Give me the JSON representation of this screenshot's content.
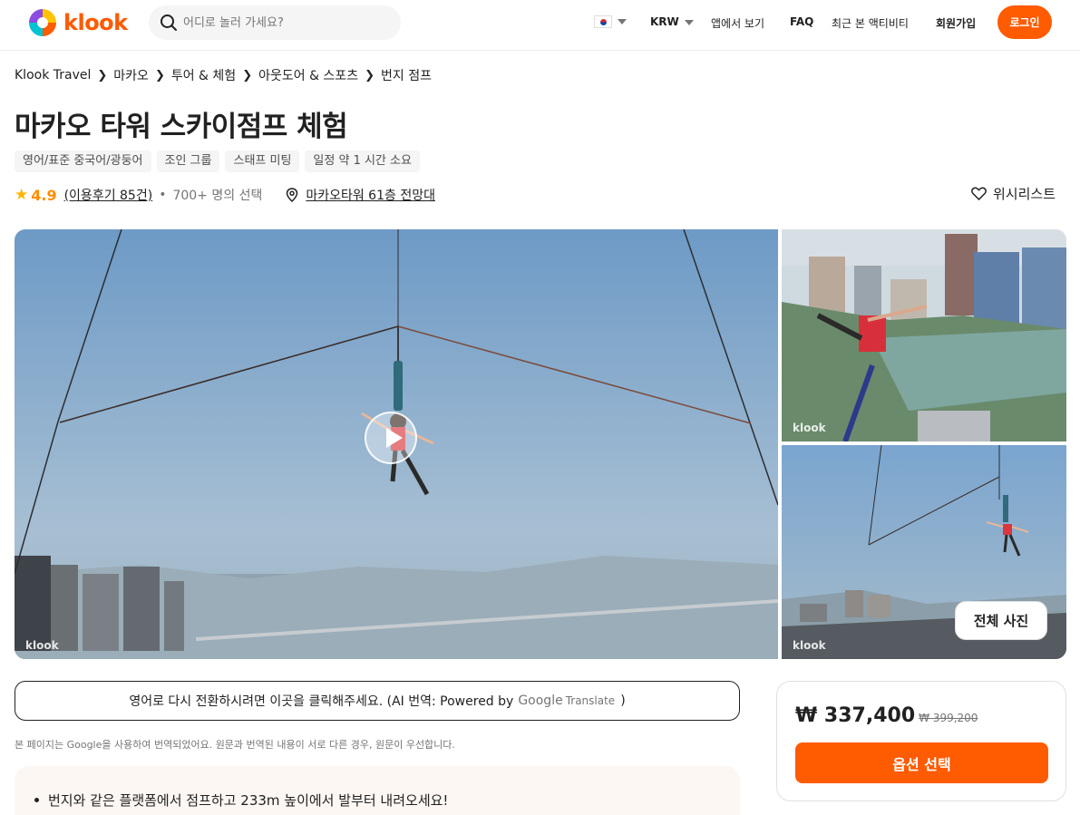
{
  "header": {
    "logo_text": "klook",
    "search_placeholder": "어디로 놀러 가세요?",
    "currency": "KRW",
    "app_link": "앱에서 보기",
    "faq": "FAQ",
    "recent": "최근 본 액티비티",
    "signup": "회원가입",
    "login": "로그인",
    "accent_color": "#ff5b00"
  },
  "breadcrumb": [
    "Klook Travel",
    "마카오",
    "투어 & 체험",
    "아웃도어 & 스포츠",
    "번지 점프"
  ],
  "activity": {
    "title": "마카오 타워 스카이점프 체험",
    "tags": [
      "영어/표준 중국어/광둥어",
      "조인 그룹",
      "스태프 미팅",
      "일정 약 1 시간  소요"
    ],
    "rating": "4.9",
    "reviews": "(이용후기 85건)",
    "booked": "700+ 명의 선택",
    "location": "마카오타워 61층 전망대",
    "wishlist": "위시리스트"
  },
  "gallery": {
    "watermark": "klook",
    "all_photos": "전체 사진"
  },
  "translate": {
    "button_text": "영어로 다시 전환하시려면 이곳을 클릭해주세요. (AI 번역: Powered by",
    "google": "Google",
    "translate_word": "Translate",
    "close_paren": ")",
    "note": "본 페이지는 Google을 사용하여 번역되었어요. 원문과 번역된 내용이 서로 다른 경우, 원문이 우선합니다."
  },
  "highlights": [
    "번지와 같은 플랫폼에서 점프하고 233m 높이에서 발부터 내려오세요!"
  ],
  "price_card": {
    "price": "₩ 337,400",
    "original_price": "₩ 399,200",
    "select_button": "옵션 선택"
  }
}
